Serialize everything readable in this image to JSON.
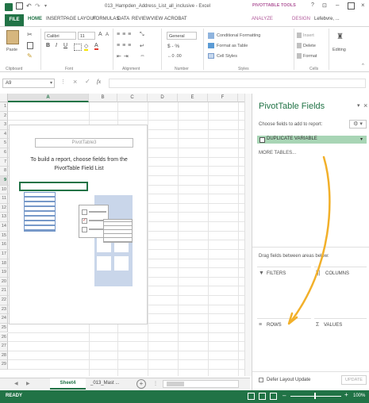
{
  "window": {
    "title": "013_Hampden_Address_List_all_inclusive - Excel",
    "context_tab": "PIVOTTABLE TOOLS",
    "user": "Lefebvre, ..."
  },
  "ribbon_tabs": [
    "FILE",
    "HOME",
    "INSERT",
    "PAGE LAYOUT",
    "FORMULAS",
    "DATA",
    "REVIEW",
    "VIEW",
    "ACROBAT",
    "ANALYZE",
    "DESIGN"
  ],
  "ribbon": {
    "paste_label": "Paste",
    "font_name": "Calibri",
    "font_size": "11",
    "number_format": "General",
    "number_symbols": "$ - %",
    "conditional_formatting": "Conditional Formatting",
    "format_as_table": "Format as Table",
    "cell_styles": "Cell Styles",
    "insert": "Insert",
    "delete": "Delete",
    "format": "Format",
    "editing": "Editing",
    "groups": [
      "Clipboard",
      "Font",
      "Alignment",
      "Number",
      "Styles",
      "Cells"
    ]
  },
  "formula_bar": {
    "name_box": "A9",
    "fx": "fx",
    "content": ""
  },
  "grid": {
    "columns": [
      "A",
      "B",
      "C",
      "D",
      "E",
      "F"
    ],
    "rows": [
      "1",
      "2",
      "3",
      "4",
      "5",
      "6",
      "7",
      "8",
      "9",
      "10",
      "11",
      "12",
      "13",
      "14",
      "15",
      "16",
      "17",
      "18",
      "19",
      "20",
      "21",
      "22",
      "23",
      "24",
      "25",
      "26",
      "27",
      "28",
      "29"
    ],
    "selected_cell": "A9"
  },
  "pivot_placeholder": {
    "name": "PivotTable3",
    "instruction": "To build a report, choose fields from the PivotTable Field List"
  },
  "sheet_tabs": {
    "tabs": [
      "Sheet4",
      "_013_Mast ..."
    ],
    "active": "Sheet4",
    "add": "+"
  },
  "status": {
    "ready": "READY",
    "zoom": "100%"
  },
  "pivot_fields": {
    "title": "PivotTable Fields",
    "choose_label": "Choose fields to add to report:",
    "fields": [
      "DUPLICATE VARIABLE"
    ],
    "more_tables": "MORE TABLES...",
    "drag_label": "Drag fields between areas below:",
    "areas": {
      "filters": "FILTERS",
      "columns": "COLUMNS",
      "rows": "ROWS",
      "values": "VALUES"
    },
    "defer_label": "Defer Layout Update",
    "update_button": "UPDATE"
  },
  "colors": {
    "excel_green": "#217346",
    "pivot_accent": "#e8a23c",
    "field_highlight": "#a8d5b5",
    "arrow": "#f2b02a"
  }
}
